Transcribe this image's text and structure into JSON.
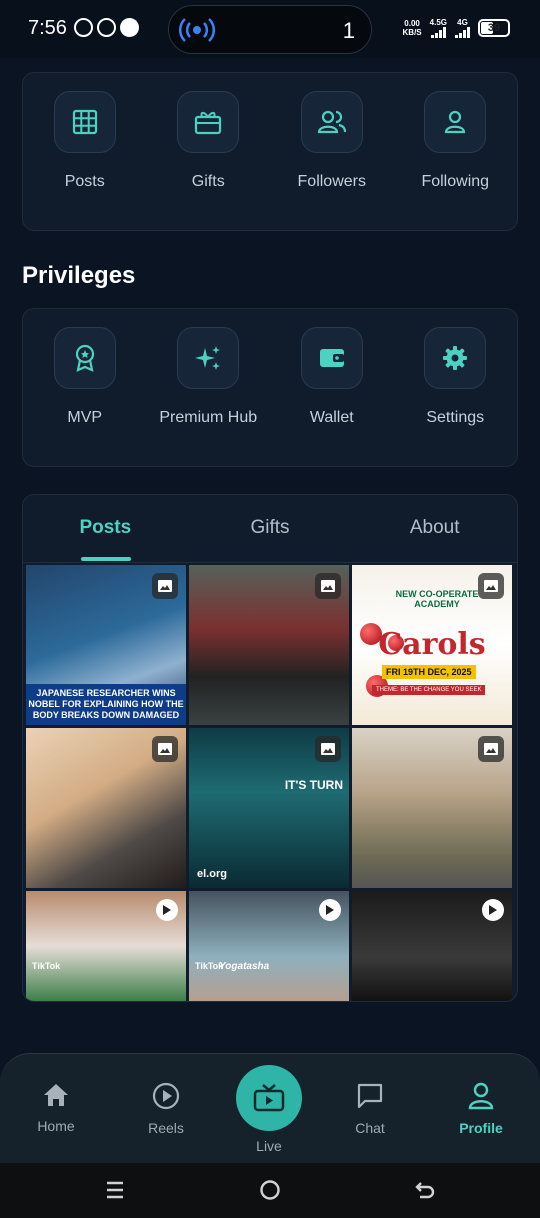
{
  "status_bar": {
    "time": "7:56",
    "island_count": "1",
    "net_speed_top": "0.00",
    "net_speed_bottom": "KB/S",
    "sig1_label": "4.5G",
    "sig2_label": "4G",
    "battery": "39"
  },
  "stats": [
    {
      "label": "Posts",
      "icon": "grid-icon"
    },
    {
      "label": "Gifts",
      "icon": "gift-icon"
    },
    {
      "label": "Followers",
      "icon": "followers-icon"
    },
    {
      "label": "Following",
      "icon": "person-icon"
    }
  ],
  "privileges": {
    "title": "Privileges",
    "items": [
      {
        "label": "MVP",
        "icon": "badge-icon"
      },
      {
        "label": "Premium Hub",
        "icon": "sparkles-icon"
      },
      {
        "label": "Wallet",
        "icon": "wallet-icon"
      },
      {
        "label": "Settings",
        "icon": "gear-icon"
      }
    ]
  },
  "tabs": [
    {
      "label": "Posts",
      "active": true
    },
    {
      "label": "Gifts",
      "active": false
    },
    {
      "label": "About",
      "active": false
    }
  ],
  "posts": {
    "p1_caption": "JAPANESE RESEARCHER WINS NOBEL FOR EXPLAINING HOW THE BODY BREAKS DOWN DAMAGED",
    "p3_small": "NEW CO-OPERATE ACADEMY",
    "p3_title": "Carols",
    "p3_date": "FRI 19TH DEC, 2025",
    "p3_theme": "THEME: BE THE CHANGE YOU SEEK",
    "p5_side": "IT'S TURN",
    "p5_url": "el.org",
    "p7_tiktok": "TikTok",
    "p8_tiktok": "TikTok",
    "p8_name": "Yogatasha"
  },
  "bottom_nav": {
    "home": "Home",
    "reels": "Reels",
    "live": "Live",
    "chat": "Chat",
    "profile": "Profile"
  },
  "colors": {
    "accent": "#4fd1c1",
    "background": "#0b1422",
    "card": "#101c2c"
  }
}
